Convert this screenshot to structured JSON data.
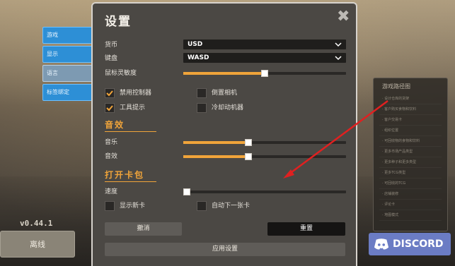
{
  "background": {
    "left_tabs": [
      "游戏",
      "显示",
      "语言",
      "标签绑定"
    ],
    "version": "v0.44.1",
    "left_button": "离线",
    "right_panel": {
      "title": "游戏路径图",
      "items": [
        "· 设计仓库的货架",
        "· 客户购买食物和饮料",
        "· 客户交易卡",
        "· 组织位置",
        "· 可回收物的食物和饮料",
        "· 更多市场产品类型",
        "· 更多种子和更多类型",
        "· 更多TCG类型",
        "· 可回收的TCG",
        "· 店铺装修",
        "· 评论卡",
        "· 地图模式"
      ]
    },
    "discord_label": "DISCORD"
  },
  "dialog": {
    "title": "设置",
    "currency_label": "货币",
    "currency_value": "USD",
    "keyboard_label": "键盘",
    "keyboard_value": "WASD",
    "mouse_sensitivity_label": "鼠标灵敏度",
    "mouse_sensitivity": 0.5,
    "checkboxes": [
      {
        "label": "禁用控制器",
        "checked": true
      },
      {
        "label": "倒置相机",
        "checked": false
      },
      {
        "label": "工具提示",
        "checked": true
      },
      {
        "label": "冷却动机器",
        "checked": false
      }
    ],
    "audio_section": "音效",
    "music_label": "音乐",
    "music_level": 0.4,
    "sfx_label": "音效",
    "sfx_level": 0.4,
    "pack_section": "打开卡包",
    "speed_label": "速度",
    "speed_level": 0.02,
    "pack_checkboxes": [
      {
        "label": "显示新卡",
        "checked": false
      },
      {
        "label": "自动下一张卡",
        "checked": false
      }
    ],
    "cancel_button": "撤消",
    "reset_button": "重置",
    "apply_button": "应用设置"
  },
  "colors": {
    "accent": "#f0a43a",
    "panel": "#4b4844",
    "blue_tab": "#2d8fd6",
    "arrow": "#e02020"
  }
}
